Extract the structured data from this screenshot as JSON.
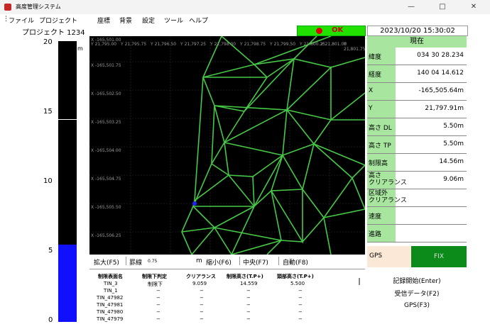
{
  "window": {
    "title": "高度管理システム",
    "minimize": "—",
    "maximize": "□",
    "close": "✕"
  },
  "menu": [
    "ファイル",
    "プロジェクト",
    "座標",
    "背景",
    "設定",
    "ツール",
    "ヘルプ"
  ],
  "project": {
    "label": "プロジェクト 1234"
  },
  "status": {
    "ok": "OK",
    "datetime": "2023/10/20 15:30:02"
  },
  "gauge": {
    "unit": "m",
    "ticks": [
      "20",
      "15",
      "10",
      "5",
      "0"
    ],
    "level": 5.5,
    "max": 20
  },
  "map": {
    "y_labels": [
      "Y 21,795.00",
      "Y 21,795.75",
      "Y 21,796.50",
      "Y 21,797.25",
      "Y 21,798.00",
      "Y 21,798.75",
      "Y 21,799.50",
      "Y 21,800.25",
      "Y 21,801.00",
      "Y 21,801.75"
    ],
    "x_labels": [
      "X -165,501.00",
      "X -165,501.75",
      "X -165,502.50",
      "X -165,503.25",
      "X -165,504.00",
      "X -165,504.75",
      "X -165,505.50",
      "X -165,506.25"
    ]
  },
  "mapbar": {
    "zoom_in": "拡大(F5)",
    "grid": "罫線",
    "grid_value": "0.75",
    "unit": "m",
    "zoom_out": "縮小(F6)",
    "center": "中央(F7)",
    "auto": "自動(F8)"
  },
  "table": {
    "headers": [
      "制限表面名",
      "制限下判定",
      "クリアランス",
      "制限高さ(T.P+)",
      "頭部高さ(T.P+)"
    ],
    "rows": [
      [
        "TIN_3",
        "制限下",
        "9.059",
        "14.559",
        "5.500"
      ],
      [
        "TIN_1",
        "−",
        "−",
        "−",
        "−"
      ],
      [
        "TIN_47982",
        "−",
        "−",
        "−",
        "−"
      ],
      [
        "TIN_47981",
        "−",
        "−",
        "−",
        "−"
      ],
      [
        "TIN_47980",
        "−",
        "−",
        "−",
        "−"
      ],
      [
        "TIN_47979",
        "−",
        "−",
        "−",
        "−"
      ]
    ]
  },
  "panel": {
    "header": "現在",
    "rows": [
      {
        "label": "緯度",
        "value": "034 30 28.234"
      },
      {
        "label": "経度",
        "value": "140 04 14.612"
      },
      {
        "label": "X",
        "value": "-165,505.64m"
      },
      {
        "label": "Y",
        "value": "21,797.91m"
      },
      {
        "label": "高さ DL",
        "value": "5.50m"
      },
      {
        "label": "高さ TP",
        "value": "5.50m"
      },
      {
        "label": "制限高",
        "value": "14.56m"
      },
      {
        "label": "高さ\nクリアランス",
        "value": "9.06m"
      },
      {
        "label": "区域外\nクリアランス",
        "value": ""
      },
      {
        "label": "速度",
        "value": ""
      },
      {
        "label": "進路",
        "value": ""
      }
    ]
  },
  "gps": {
    "label": "GPS",
    "state": "FIX"
  },
  "commands": {
    "record": "記録開始(Enter)",
    "receive": "受信データ(F2)",
    "gps": "GPS(F3)"
  },
  "colors": {
    "mesh": "#46c846",
    "gauge_fill": "#1010ff",
    "ok_green": "#22e000",
    "panel_green": "#a8e6a0",
    "fix_green": "#0c8a1a"
  }
}
